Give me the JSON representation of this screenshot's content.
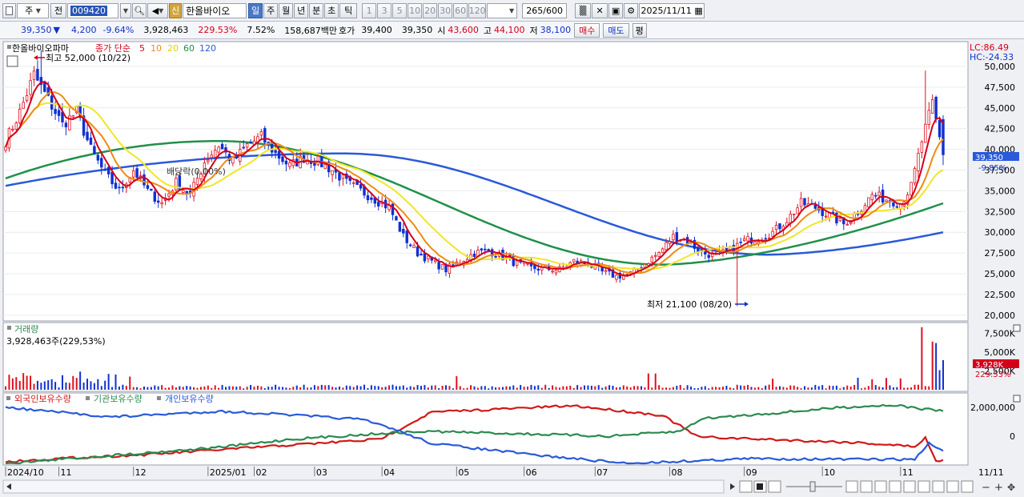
{
  "toolbar": {
    "mode": "주",
    "prev_label": "전",
    "code": "009420",
    "stock_name": "한올바이오",
    "shin_badge": "신",
    "periods": [
      "일",
      "주",
      "월",
      "년",
      "분",
      "초",
      "틱"
    ],
    "minutes": [
      "1",
      "3",
      "5",
      "10",
      "20",
      "30",
      "60",
      "120"
    ],
    "count": "265",
    "count_max": "/600",
    "date": "2025/11/11"
  },
  "quote": {
    "price": "39,350",
    "change_arrow": "▼",
    "change": "4,200",
    "change_pct": "-9.64%",
    "volume": "3,928,463",
    "volume_ratio": "229.53%",
    "turnover_pct": "7.52%",
    "amount": "158,687백만",
    "hoga_label": "호가",
    "ask": "39,400",
    "bid": "39,350",
    "open_label": "시",
    "open": "43,600",
    "high_label": "고",
    "high": "44,100",
    "low_label": "저",
    "low": "38,100",
    "buy_label": "매수",
    "sell_label": "매도",
    "eval_label": "평"
  },
  "colors": {
    "up": "#e0101e",
    "down": "#1030d0",
    "ma5": "#d4001a",
    "ma10": "#f08a14",
    "ma20": "#f0e628",
    "ma60": "#20904a",
    "ma120": "#2a5ad8",
    "foreign": "#d01818",
    "institution": "#2a8a50",
    "individual": "#2a5ad8"
  },
  "chart_data": [
    {
      "type": "candlestick",
      "title": "한올바이오파마",
      "legend": {
        "label": "종가 단순",
        "periods": [
          "5",
          "10",
          "20",
          "60",
          "120"
        ]
      },
      "lc_label": "LC:86.49",
      "hc_label": "HC:-24.33",
      "yticks": [
        20000,
        22500,
        25000,
        27500,
        30000,
        32500,
        35000,
        37500,
        40000,
        42500,
        45000,
        47500,
        50000
      ],
      "ylim": [
        19500,
        52800
      ],
      "xticks": [
        "2024/10",
        "11",
        "12",
        "2025/01",
        "02",
        "03",
        "04",
        "05",
        "06",
        "07",
        "08",
        "09",
        "10",
        "11"
      ],
      "x_range_label": "11/11",
      "high_annotation": "최고 52,000 (10/22)",
      "low_annotation": "최저 21,100 (08/20)",
      "dividend_annotation": "배당락(0.00%)",
      "last_price_label": "39,350",
      "last_pct_label": "-9.85%",
      "price_keypoints": [
        [
          0,
          41000
        ],
        [
          4,
          44500
        ],
        [
          8,
          49000
        ],
        [
          12,
          46000
        ],
        [
          16,
          43000
        ],
        [
          20,
          44500
        ],
        [
          24,
          40000
        ],
        [
          28,
          37000
        ],
        [
          32,
          35000
        ],
        [
          36,
          37500
        ],
        [
          40,
          35000
        ],
        [
          44,
          33500
        ],
        [
          48,
          36000
        ],
        [
          52,
          34500
        ],
        [
          56,
          38500
        ],
        [
          60,
          40500
        ],
        [
          64,
          38500
        ],
        [
          68,
          40500
        ],
        [
          72,
          41500
        ],
        [
          76,
          39500
        ],
        [
          80,
          38000
        ],
        [
          84,
          39000
        ],
        [
          88,
          38500
        ],
        [
          92,
          37500
        ],
        [
          96,
          36000
        ],
        [
          100,
          35000
        ],
        [
          104,
          34000
        ],
        [
          108,
          33000
        ],
        [
          112,
          29500
        ],
        [
          116,
          27500
        ],
        [
          120,
          26500
        ],
        [
          124,
          25500
        ],
        [
          128,
          26500
        ],
        [
          132,
          27500
        ],
        [
          136,
          27800
        ],
        [
          140,
          27000
        ],
        [
          144,
          26200
        ],
        [
          148,
          25700
        ],
        [
          152,
          25600
        ],
        [
          156,
          25500
        ],
        [
          160,
          26500
        ],
        [
          164,
          26200
        ],
        [
          168,
          25200
        ],
        [
          172,
          24700
        ],
        [
          176,
          25000
        ],
        [
          180,
          26200
        ],
        [
          184,
          27500
        ],
        [
          188,
          29500
        ],
        [
          192,
          29000
        ],
        [
          196,
          27500
        ],
        [
          200,
          27200
        ],
        [
          204,
          27800
        ],
        [
          208,
          29000
        ],
        [
          212,
          29300
        ],
        [
          216,
          30000
        ],
        [
          220,
          31500
        ],
        [
          224,
          33500
        ],
        [
          228,
          33000
        ],
        [
          232,
          32000
        ],
        [
          236,
          31000
        ],
        [
          240,
          32500
        ],
        [
          244,
          34500
        ],
        [
          248,
          34000
        ],
        [
          252,
          33500
        ],
        [
          255,
          35500
        ],
        [
          258,
          41000
        ],
        [
          261,
          45500
        ],
        [
          264,
          39350
        ]
      ],
      "ma_levels": {
        "ma60_start": 36500,
        "ma60_mid": 41000,
        "ma60_low": 26100,
        "ma60_end": 33500,
        "ma120_start": 35600,
        "ma120_mid": 39500,
        "ma120_low": 27300,
        "ma120_end": 30000
      }
    },
    {
      "type": "bar",
      "title": "거래량",
      "info": "3,928,463주(229,53%)",
      "yticks": [
        "2,500K",
        "5,000K",
        "7,500K"
      ],
      "ylim": [
        0,
        8500
      ],
      "last_label": "3,928K",
      "last_pct_label": "229.53%"
    },
    {
      "type": "line",
      "series": [
        {
          "name": "외국인보유수량"
        },
        {
          "name": "기관보유수량"
        },
        {
          "name": "개인보유수량"
        }
      ],
      "yticks": [
        "2,000,000",
        "0"
      ]
    }
  ]
}
